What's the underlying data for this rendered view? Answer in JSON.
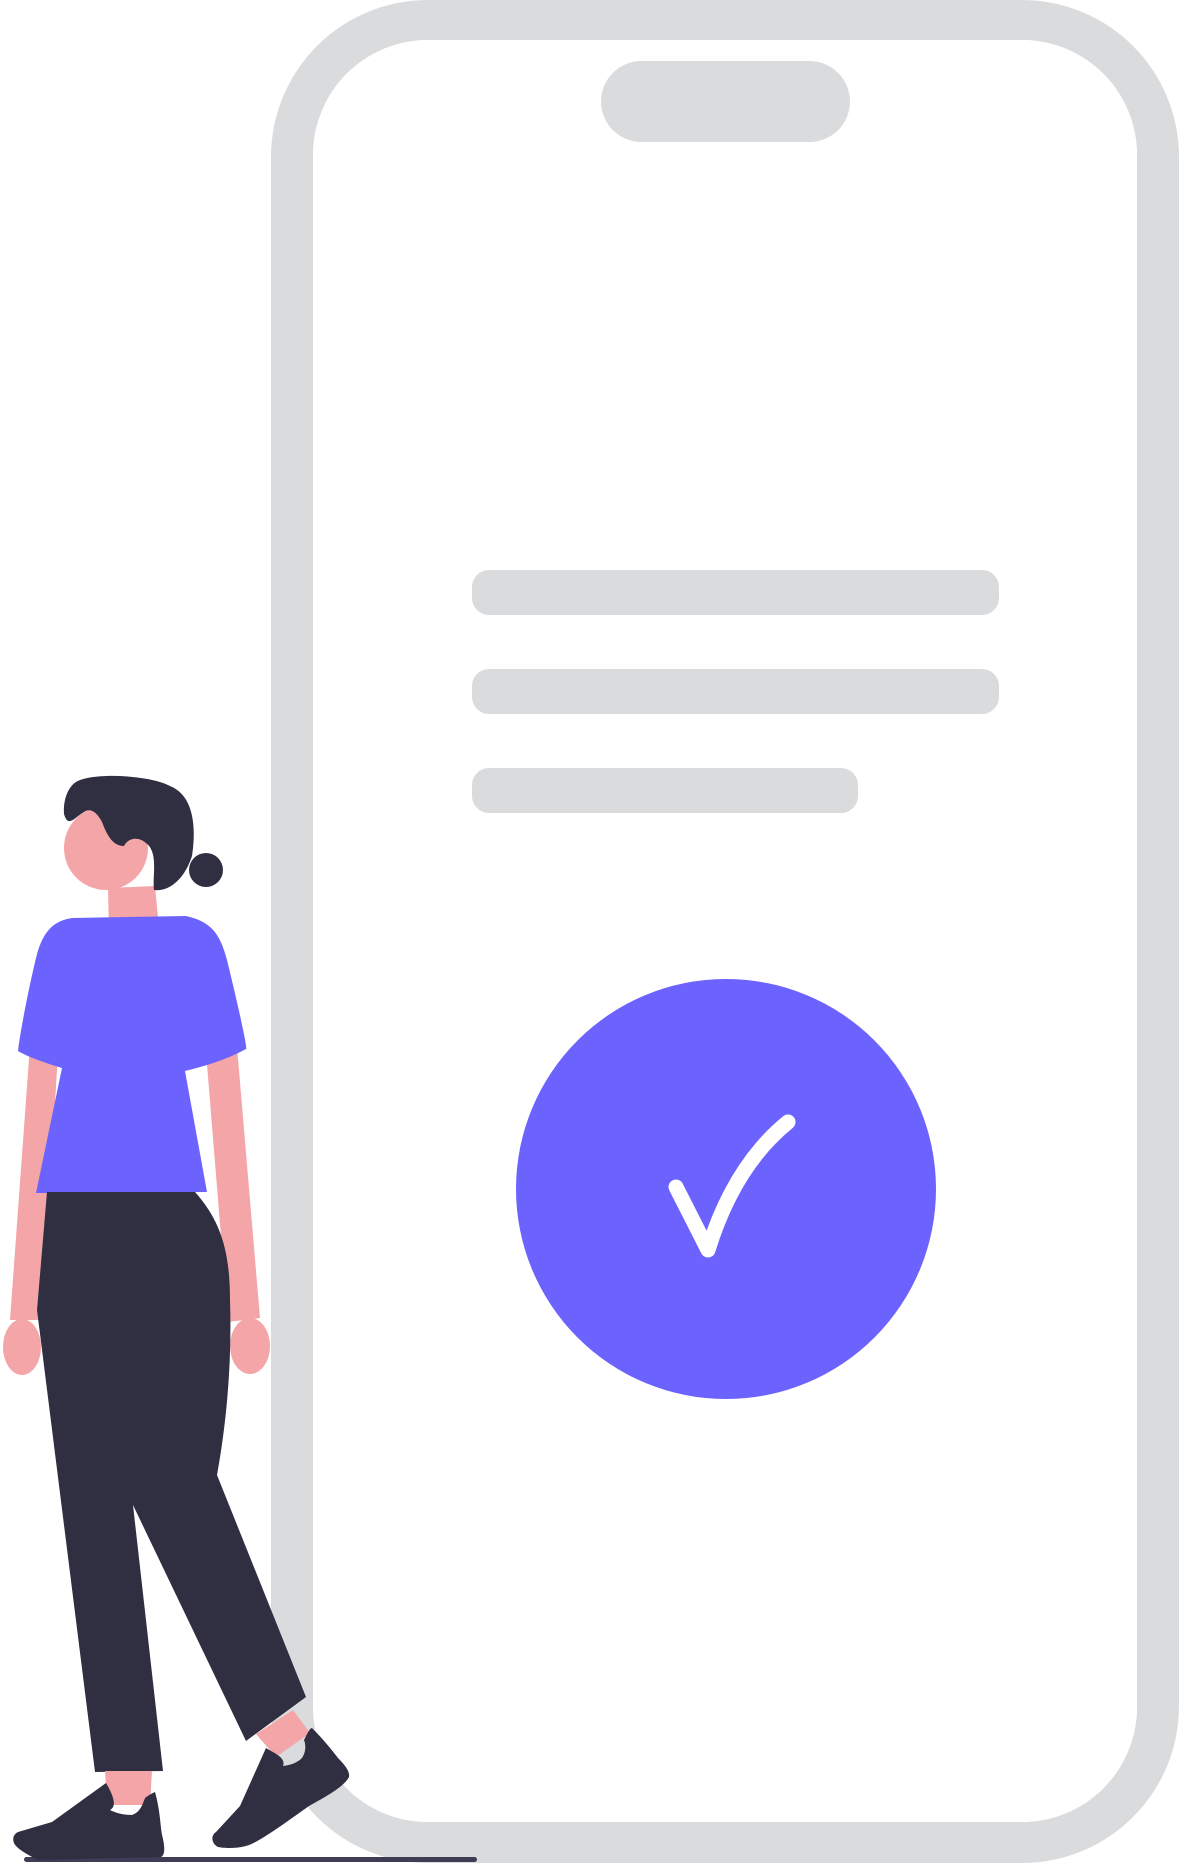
{
  "illustration": {
    "subject": "phone-success-confirmation",
    "colors": {
      "frame": "#dadbdd",
      "screen": "#ffffff",
      "accent": "#6c63ff",
      "check": "#ffffff",
      "skin": "#f4a5a8",
      "dark": "#302f42",
      "ground": "#3f3d56"
    },
    "status_icon": "checkmark-icon",
    "text_placeholder_lines": 3
  }
}
